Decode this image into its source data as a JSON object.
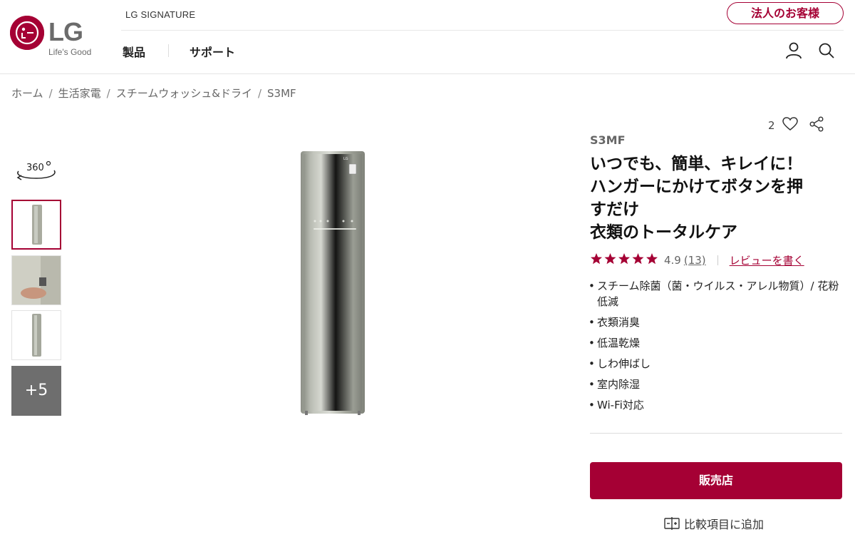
{
  "brand": {
    "logo_text": "LG",
    "tagline": "Life's Good",
    "signature": "LG SIGNATURE",
    "accent_color": "#a50034"
  },
  "header": {
    "corp_button": "法人のお客様",
    "nav": [
      "製品",
      "サポート"
    ],
    "icons": [
      "user-icon",
      "search-icon"
    ]
  },
  "breadcrumb": [
    "ホーム",
    "生活家電",
    "スチームウォッシュ&ドライ",
    "S3MF"
  ],
  "gallery": {
    "icon_360": "360°",
    "more_label": "+5"
  },
  "product": {
    "wishlist_count": "2",
    "model": "S3MF",
    "title_lines": [
      "いつでも、簡単、キレイに！",
      "ハンガーにかけてボタンを押",
      "すだけ",
      "衣類のトータルケア"
    ],
    "rating": "4.9",
    "review_count": "(13)",
    "rating_stars": 4.9,
    "write_review": "レビューを書く",
    "features": [
      "スチーム除菌（菌・ウイルス・アレル物質）/ 花粉低減",
      "衣類消臭",
      "低温乾燥",
      "しわ伸ばし",
      "室内除湿",
      "Wi-Fi対応"
    ],
    "buy_button": "販売店",
    "compare_label": "比較項目に追加"
  }
}
